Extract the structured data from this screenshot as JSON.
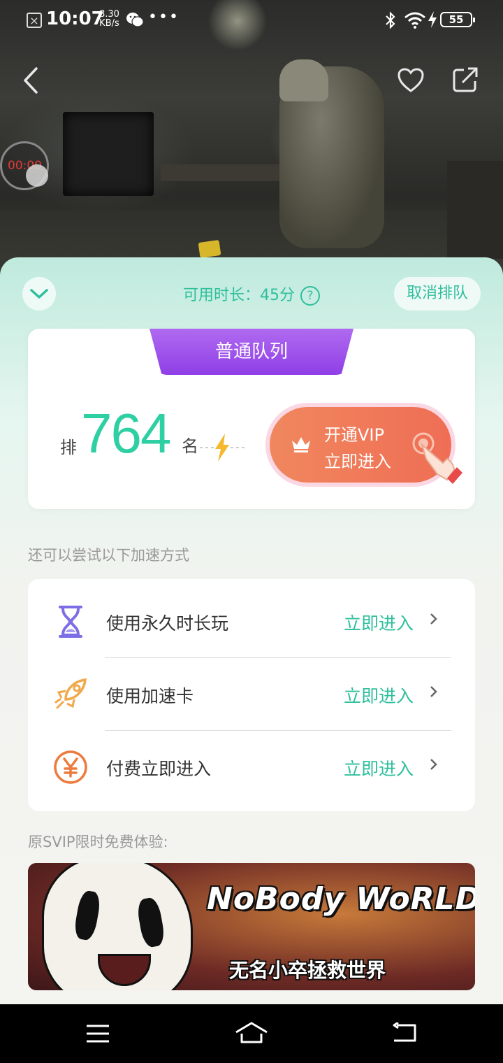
{
  "status_bar": {
    "time": "10:07",
    "net_speed_value": "8.30",
    "net_speed_unit": "KB/s",
    "dots": "•••",
    "battery": "55"
  },
  "player": {
    "timer": "00:00"
  },
  "sheet": {
    "available_time": "可用时长：45分",
    "help_icon_text": "?",
    "cancel_label": "取消排队"
  },
  "queue": {
    "tab_label": "普通队列",
    "rank_prefix": "排",
    "rank_number": "764",
    "rank_suffix": "名",
    "vip_line1": "开通VIP",
    "vip_line2": "立即进入"
  },
  "alternatives": {
    "hint": "还可以尝试以下加速方式",
    "items": [
      {
        "label": "使用永久时长玩",
        "action": "立即进入",
        "icon": "hourglass-icon"
      },
      {
        "label": "使用加速卡",
        "action": "立即进入",
        "icon": "rocket-icon"
      },
      {
        "label": "付费立即进入",
        "action": "立即进入",
        "icon": "yen-icon"
      }
    ]
  },
  "promo": {
    "title": "原SVIP限时免费体验:",
    "banner_logo": "NoBody WoRLD",
    "banner_subtitle": "无名小卒拯救世界"
  },
  "colors": {
    "accent": "#2fbf9d",
    "vip_orange": "#ef6e55",
    "queue_purple": "#9a4ee8"
  }
}
